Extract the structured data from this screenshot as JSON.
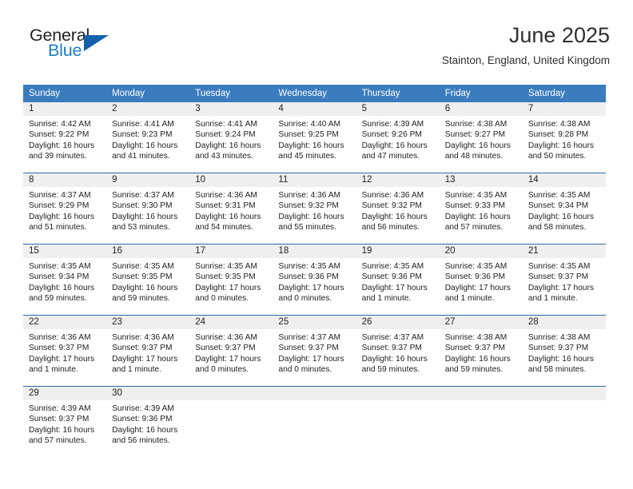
{
  "brand": {
    "line1": "General",
    "line2": "Blue",
    "triangle_color": "#1361ab",
    "blue_color": "#1d7dc4"
  },
  "header": {
    "title": "June 2025",
    "location": "Stainton, England, United Kingdom"
  },
  "theme": {
    "header_blue": "#3a7cbe",
    "row_rule_blue": "#2b6cac",
    "daynum_band": "#efefef"
  },
  "weekday_headers": [
    "Sunday",
    "Monday",
    "Tuesday",
    "Wednesday",
    "Thursday",
    "Friday",
    "Saturday"
  ],
  "weeks": [
    [
      {
        "day": "1",
        "sunrise": "Sunrise: 4:42 AM",
        "sunset": "Sunset: 9:22 PM",
        "daylight1": "Daylight: 16 hours",
        "daylight2": "and 39 minutes."
      },
      {
        "day": "2",
        "sunrise": "Sunrise: 4:41 AM",
        "sunset": "Sunset: 9:23 PM",
        "daylight1": "Daylight: 16 hours",
        "daylight2": "and 41 minutes."
      },
      {
        "day": "3",
        "sunrise": "Sunrise: 4:41 AM",
        "sunset": "Sunset: 9:24 PM",
        "daylight1": "Daylight: 16 hours",
        "daylight2": "and 43 minutes."
      },
      {
        "day": "4",
        "sunrise": "Sunrise: 4:40 AM",
        "sunset": "Sunset: 9:25 PM",
        "daylight1": "Daylight: 16 hours",
        "daylight2": "and 45 minutes."
      },
      {
        "day": "5",
        "sunrise": "Sunrise: 4:39 AM",
        "sunset": "Sunset: 9:26 PM",
        "daylight1": "Daylight: 16 hours",
        "daylight2": "and 47 minutes."
      },
      {
        "day": "6",
        "sunrise": "Sunrise: 4:38 AM",
        "sunset": "Sunset: 9:27 PM",
        "daylight1": "Daylight: 16 hours",
        "daylight2": "and 48 minutes."
      },
      {
        "day": "7",
        "sunrise": "Sunrise: 4:38 AM",
        "sunset": "Sunset: 9:28 PM",
        "daylight1": "Daylight: 16 hours",
        "daylight2": "and 50 minutes."
      }
    ],
    [
      {
        "day": "8",
        "sunrise": "Sunrise: 4:37 AM",
        "sunset": "Sunset: 9:29 PM",
        "daylight1": "Daylight: 16 hours",
        "daylight2": "and 51 minutes."
      },
      {
        "day": "9",
        "sunrise": "Sunrise: 4:37 AM",
        "sunset": "Sunset: 9:30 PM",
        "daylight1": "Daylight: 16 hours",
        "daylight2": "and 53 minutes."
      },
      {
        "day": "10",
        "sunrise": "Sunrise: 4:36 AM",
        "sunset": "Sunset: 9:31 PM",
        "daylight1": "Daylight: 16 hours",
        "daylight2": "and 54 minutes."
      },
      {
        "day": "11",
        "sunrise": "Sunrise: 4:36 AM",
        "sunset": "Sunset: 9:32 PM",
        "daylight1": "Daylight: 16 hours",
        "daylight2": "and 55 minutes."
      },
      {
        "day": "12",
        "sunrise": "Sunrise: 4:36 AM",
        "sunset": "Sunset: 9:32 PM",
        "daylight1": "Daylight: 16 hours",
        "daylight2": "and 56 minutes."
      },
      {
        "day": "13",
        "sunrise": "Sunrise: 4:35 AM",
        "sunset": "Sunset: 9:33 PM",
        "daylight1": "Daylight: 16 hours",
        "daylight2": "and 57 minutes."
      },
      {
        "day": "14",
        "sunrise": "Sunrise: 4:35 AM",
        "sunset": "Sunset: 9:34 PM",
        "daylight1": "Daylight: 16 hours",
        "daylight2": "and 58 minutes."
      }
    ],
    [
      {
        "day": "15",
        "sunrise": "Sunrise: 4:35 AM",
        "sunset": "Sunset: 9:34 PM",
        "daylight1": "Daylight: 16 hours",
        "daylight2": "and 59 minutes."
      },
      {
        "day": "16",
        "sunrise": "Sunrise: 4:35 AM",
        "sunset": "Sunset: 9:35 PM",
        "daylight1": "Daylight: 16 hours",
        "daylight2": "and 59 minutes."
      },
      {
        "day": "17",
        "sunrise": "Sunrise: 4:35 AM",
        "sunset": "Sunset: 9:35 PM",
        "daylight1": "Daylight: 17 hours",
        "daylight2": "and 0 minutes."
      },
      {
        "day": "18",
        "sunrise": "Sunrise: 4:35 AM",
        "sunset": "Sunset: 9:36 PM",
        "daylight1": "Daylight: 17 hours",
        "daylight2": "and 0 minutes."
      },
      {
        "day": "19",
        "sunrise": "Sunrise: 4:35 AM",
        "sunset": "Sunset: 9:36 PM",
        "daylight1": "Daylight: 17 hours",
        "daylight2": "and 1 minute."
      },
      {
        "day": "20",
        "sunrise": "Sunrise: 4:35 AM",
        "sunset": "Sunset: 9:36 PM",
        "daylight1": "Daylight: 17 hours",
        "daylight2": "and 1 minute."
      },
      {
        "day": "21",
        "sunrise": "Sunrise: 4:35 AM",
        "sunset": "Sunset: 9:37 PM",
        "daylight1": "Daylight: 17 hours",
        "daylight2": "and 1 minute."
      }
    ],
    [
      {
        "day": "22",
        "sunrise": "Sunrise: 4:36 AM",
        "sunset": "Sunset: 9:37 PM",
        "daylight1": "Daylight: 17 hours",
        "daylight2": "and 1 minute."
      },
      {
        "day": "23",
        "sunrise": "Sunrise: 4:36 AM",
        "sunset": "Sunset: 9:37 PM",
        "daylight1": "Daylight: 17 hours",
        "daylight2": "and 1 minute."
      },
      {
        "day": "24",
        "sunrise": "Sunrise: 4:36 AM",
        "sunset": "Sunset: 9:37 PM",
        "daylight1": "Daylight: 17 hours",
        "daylight2": "and 0 minutes."
      },
      {
        "day": "25",
        "sunrise": "Sunrise: 4:37 AM",
        "sunset": "Sunset: 9:37 PM",
        "daylight1": "Daylight: 17 hours",
        "daylight2": "and 0 minutes."
      },
      {
        "day": "26",
        "sunrise": "Sunrise: 4:37 AM",
        "sunset": "Sunset: 9:37 PM",
        "daylight1": "Daylight: 16 hours",
        "daylight2": "and 59 minutes."
      },
      {
        "day": "27",
        "sunrise": "Sunrise: 4:38 AM",
        "sunset": "Sunset: 9:37 PM",
        "daylight1": "Daylight: 16 hours",
        "daylight2": "and 59 minutes."
      },
      {
        "day": "28",
        "sunrise": "Sunrise: 4:38 AM",
        "sunset": "Sunset: 9:37 PM",
        "daylight1": "Daylight: 16 hours",
        "daylight2": "and 58 minutes."
      }
    ],
    [
      {
        "day": "29",
        "sunrise": "Sunrise: 4:39 AM",
        "sunset": "Sunset: 9:37 PM",
        "daylight1": "Daylight: 16 hours",
        "daylight2": "and 57 minutes."
      },
      {
        "day": "30",
        "sunrise": "Sunrise: 4:39 AM",
        "sunset": "Sunset: 9:36 PM",
        "daylight1": "Daylight: 16 hours",
        "daylight2": "and 56 minutes."
      },
      {
        "day": "",
        "sunrise": "",
        "sunset": "",
        "daylight1": "",
        "daylight2": ""
      },
      {
        "day": "",
        "sunrise": "",
        "sunset": "",
        "daylight1": "",
        "daylight2": ""
      },
      {
        "day": "",
        "sunrise": "",
        "sunset": "",
        "daylight1": "",
        "daylight2": ""
      },
      {
        "day": "",
        "sunrise": "",
        "sunset": "",
        "daylight1": "",
        "daylight2": ""
      },
      {
        "day": "",
        "sunrise": "",
        "sunset": "",
        "daylight1": "",
        "daylight2": ""
      }
    ]
  ]
}
